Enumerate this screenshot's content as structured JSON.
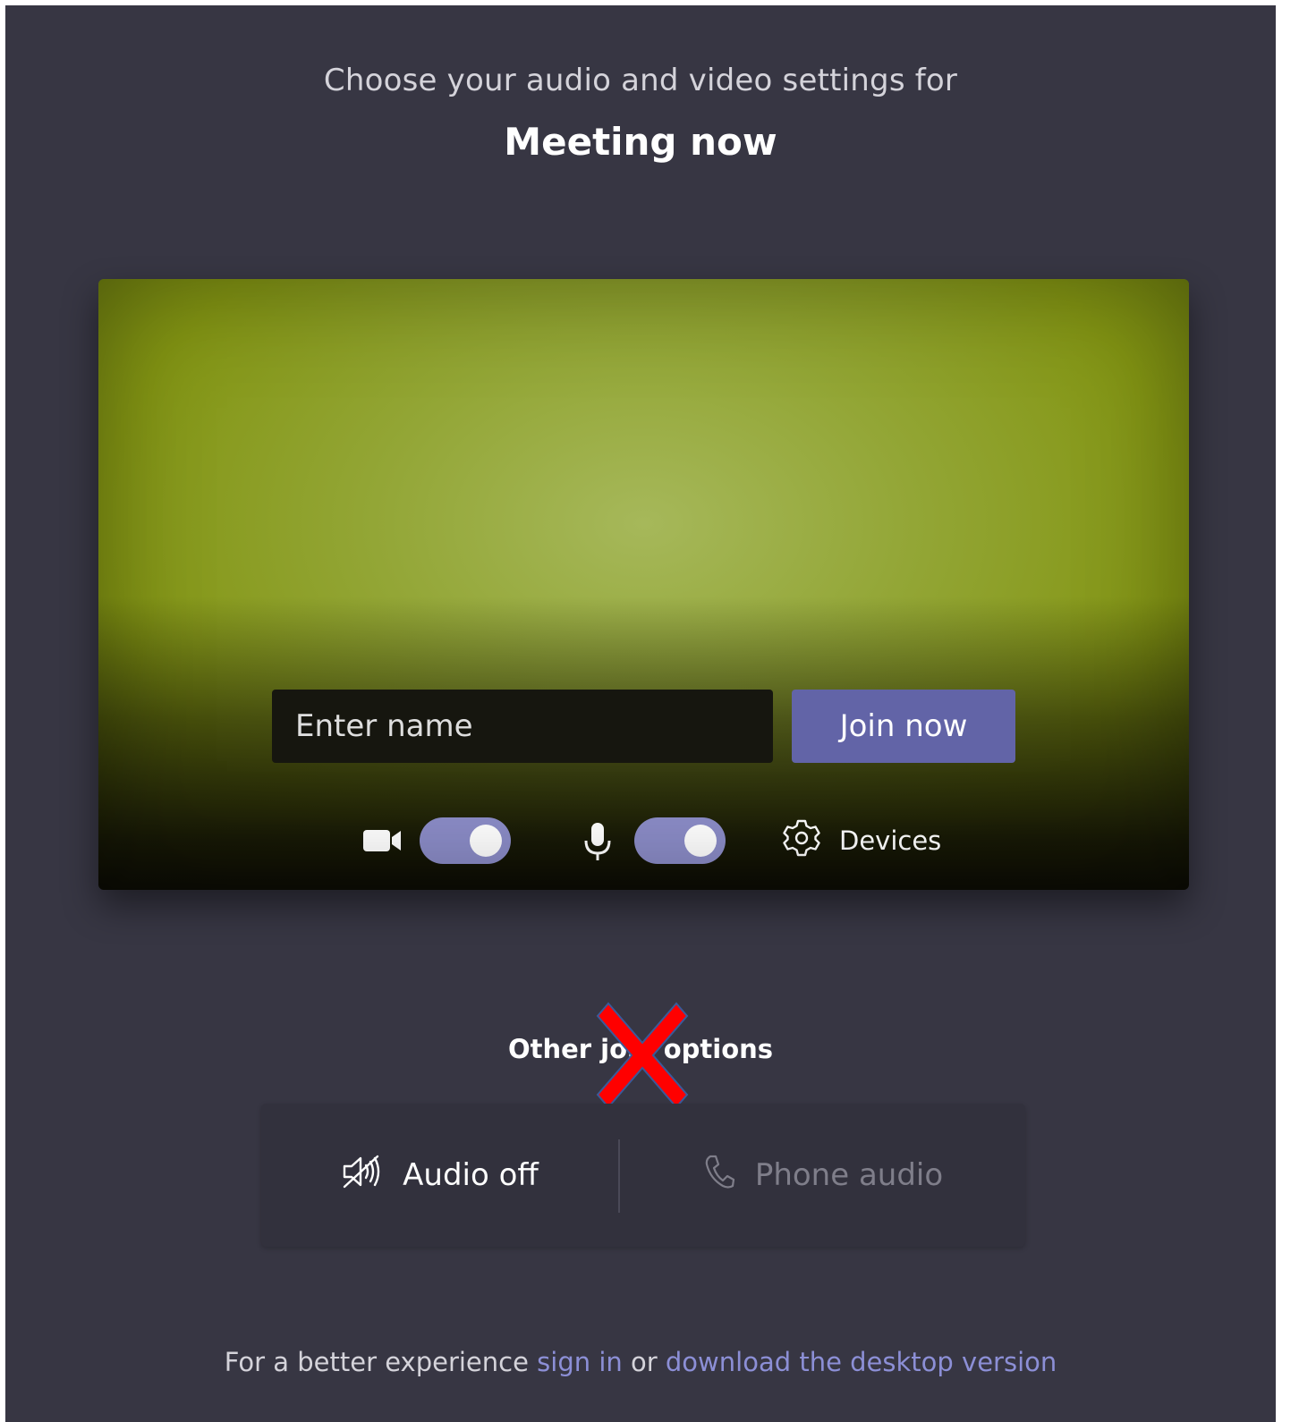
{
  "header": {
    "subtitle": "Choose your audio and video settings for",
    "meeting_title": "Meeting now"
  },
  "preview": {
    "name_input_placeholder": "Enter name",
    "name_input_value": "",
    "join_button_label": "Join now",
    "camera_toggle_on": true,
    "mic_toggle_on": true,
    "devices_label": "Devices"
  },
  "other_options": {
    "label": "Other join options",
    "audio_off_label": "Audio off",
    "phone_audio_label": "Phone audio"
  },
  "footer": {
    "prefix": "For a better experience ",
    "sign_in_link": "sign in",
    "middle": " or ",
    "download_link": "download the desktop version"
  },
  "colors": {
    "background": "#373643",
    "accent": "#6264a7",
    "toggle_on": "#8b8cc7",
    "link": "#8c8fd6",
    "annotation_x": "#ff0000"
  }
}
